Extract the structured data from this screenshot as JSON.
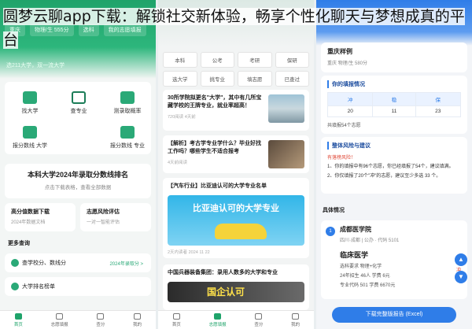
{
  "headline": "圆梦云聊app下载：解锁社交新体验，畅享个性化聊天与梦想成真的平台",
  "panel1": {
    "tabs": [
      "重庆",
      "物理/生 555分",
      "选科"
    ],
    "tabs_right": "我的志愿填报",
    "subtitle": "选211大学，双一流大学",
    "grid": [
      {
        "label": "找大学",
        "icon": "graduation-cap-icon"
      },
      {
        "label": "查专业",
        "icon": "book-icon"
      },
      {
        "label": "测录取概率",
        "icon": "chart-icon"
      },
      {
        "label": "报分数线 大学",
        "icon": "score-icon"
      },
      {
        "label": "",
        "icon": "placeholder-icon"
      },
      {
        "label": "报分数线 专业",
        "icon": "score-icon"
      }
    ],
    "rank_title": "本科大学2024年录取分数线排名",
    "rank_sub": "点击下载表格，查看全部数据",
    "two": [
      {
        "title": "高分值数据下载",
        "sub": "2024年数据文档"
      },
      {
        "title": "志愿风险评估",
        "sub": "一对一智能评估"
      }
    ],
    "more": "更多查询",
    "rows": [
      {
        "label": "查学校分、数线分",
        "right": "2024年录取分 >"
      },
      {
        "label": "大学排名榜单",
        "right": ""
      }
    ],
    "nav": [
      "首页",
      "志愿填报",
      "查分",
      "我的"
    ]
  },
  "panel2": {
    "tags": [
      "本科",
      "公考",
      "考研",
      "保研",
      "选大学",
      "挑专业",
      "填志愿",
      "已查过"
    ],
    "articles": [
      {
        "title": "30所学院拟更名\"大学\"，其中有几所宝藏学校的王牌专业，就业率超高！",
        "meta": "720阅读 4天前"
      },
      {
        "title": "【解析】考古学专业学什么？毕业好找工作吗？哪些学生不适合报考",
        "meta": "4天前阅读"
      },
      {
        "title": "【汽车行业】比亚迪认可的大学专业名单",
        "meta": "2天内读者 2024 11 22"
      },
      {
        "title": "中国兵器装备集团：录用人数多的大学和专业",
        "meta": ""
      }
    ],
    "banner_text": "比亚迪认可的大学专业",
    "banner2_text": "国企认可",
    "nav": [
      "首页",
      "志愿填报",
      "查分",
      "我的"
    ]
  },
  "panel3": {
    "header": "志愿风险评估报告",
    "card1_title": "重庆样例",
    "card1_sub": "重庆  物理/生  580分",
    "section1": "你的填报情况",
    "table_head": [
      "冲",
      "稳",
      "保"
    ],
    "table_row": [
      "20",
      "11",
      "23"
    ],
    "total": "共填报54个志愿",
    "section2": "整体风险与建议",
    "risk": "有落榜风险！",
    "advice1": "1、你的填报中有96个志愿，你已经填报了54个，建议填满。",
    "advice2": "2、你仅填报了20个\"冲\"的志愿，建议至少多选 33 个。",
    "detail": "具体情况",
    "school_num": "1",
    "school": "成都医学院",
    "school_sub": "四川·成都 | 公办 · 代码 5101",
    "major": "临床医学",
    "major_tag": "冲",
    "major_kv": [
      "选科要求 物理+化学",
      "24年招生 46人   学费 6元",
      "专业代码 501    学费 6670元"
    ],
    "download": "下载完整版报告 (Excel)"
  }
}
